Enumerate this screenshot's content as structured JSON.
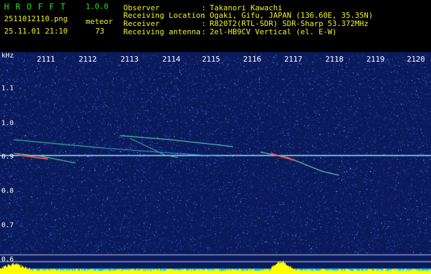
{
  "header": {
    "app_title": "H R O F F T",
    "version": "1.0.0",
    "filename": "2511012110.png",
    "mode": "meteor",
    "timestamp": "25.11.01 21:10",
    "count": "73",
    "info": [
      {
        "label": "Observer",
        "sep": ":",
        "value": "Takanori Kawachi"
      },
      {
        "label": "Receiving Location",
        "sep": ":",
        "value": "Ogaki, Gifu, JAPAN (136.60E, 35.35N)"
      },
      {
        "label": "Receiver",
        "sep": ":",
        "value": "R820T2(RTL-SDR) SDR-Sharp 53.372MHz"
      },
      {
        "label": "Receiving antenna",
        "sep": ":",
        "value": "2el-HB9CV Vertical (el. E-W)"
      }
    ]
  },
  "spectrogram": {
    "y_unit": "kHz",
    "x_ticks": [
      "2111",
      "2112",
      "2113",
      "2114",
      "2115",
      "2116",
      "2117",
      "2118",
      "2119",
      "2120"
    ],
    "y_ticks": [
      "1.1",
      "1.0",
      "0.9",
      "0.8",
      "0.7",
      "0.6"
    ],
    "colors": {
      "background": "#0a1a5a",
      "noise": "#3a6fe0",
      "carrier": "#8ff0ff",
      "meteor_hot": "#ff5050",
      "power_bar": "#ffff00",
      "power_base": "#00c8ff"
    }
  }
}
